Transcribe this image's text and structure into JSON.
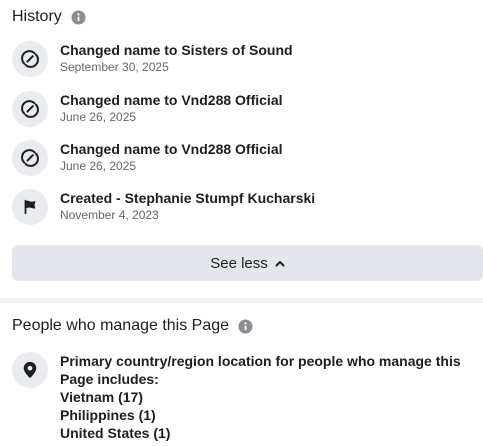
{
  "history": {
    "title": "History",
    "info_icon": "info-icon",
    "items": [
      {
        "icon": "refresh-edit-icon",
        "title": "Changed name to Sisters of Sound",
        "date": "September 30, 2025"
      },
      {
        "icon": "refresh-edit-icon",
        "title": "Changed name to Vnd288 Official",
        "date": "June 26, 2025"
      },
      {
        "icon": "refresh-edit-icon",
        "title": "Changed name to Vnd288 Official",
        "date": "June 26, 2025"
      },
      {
        "icon": "flag-icon",
        "title": "Created - Stephanie Stumpf Kucharski",
        "date": "November 4, 2023"
      }
    ],
    "see_less_label": "See less",
    "see_less_icon": "chevron-up-icon"
  },
  "managers": {
    "title": "People who manage this Page",
    "info_icon": "info-icon",
    "location_icon": "location-pin-icon",
    "location_heading": "Primary country/region location for people who manage this Page includes:",
    "countries": [
      "Vietnam (17)",
      "Philippines (1)",
      "United States (1)"
    ]
  },
  "colors": {
    "text_primary": "#1c1e21",
    "text_secondary": "#65676b",
    "button_bg": "#e4e6eb",
    "icon_circle_bg": "#e9ebee",
    "divider": "#f0f2f5"
  }
}
